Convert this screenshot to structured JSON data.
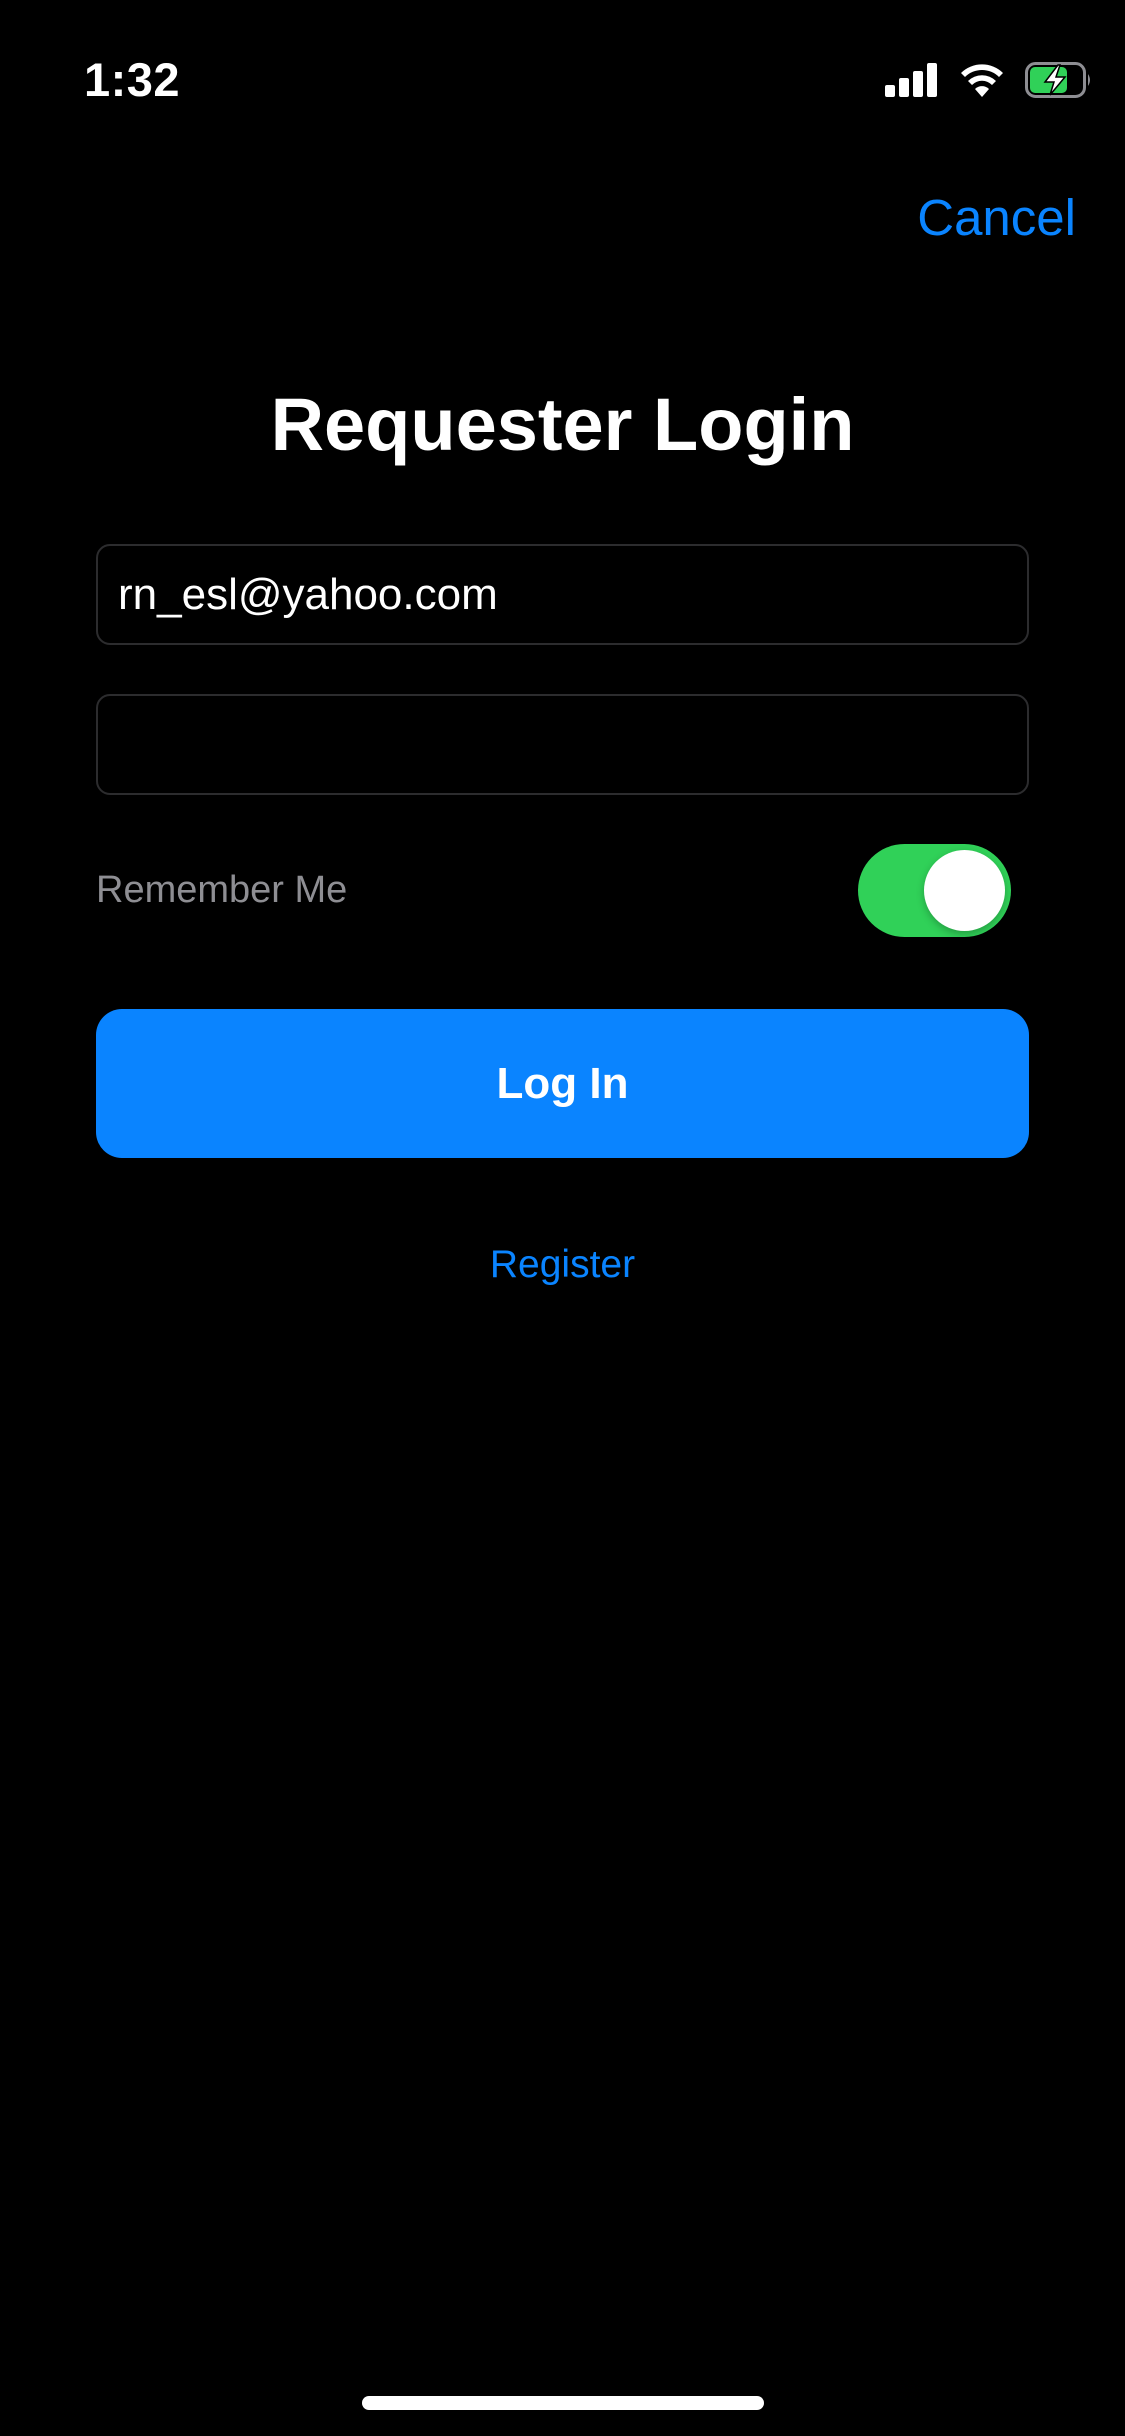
{
  "status_bar": {
    "time": "1:32",
    "signal_icon": "cellular-signal-icon",
    "wifi_icon": "wifi-icon",
    "battery_icon": "battery-charging-icon"
  },
  "nav": {
    "cancel_label": "Cancel"
  },
  "title": "Requester Login",
  "form": {
    "email_value": "rn_esl@yahoo.com",
    "password_value": "",
    "remember_label": "Remember Me",
    "remember_on": true,
    "login_label": "Log In",
    "register_label": "Register"
  },
  "colors": {
    "accent": "#0a84ff",
    "toggle_on": "#30d158",
    "background": "#000000",
    "battery_green": "#30d158"
  }
}
